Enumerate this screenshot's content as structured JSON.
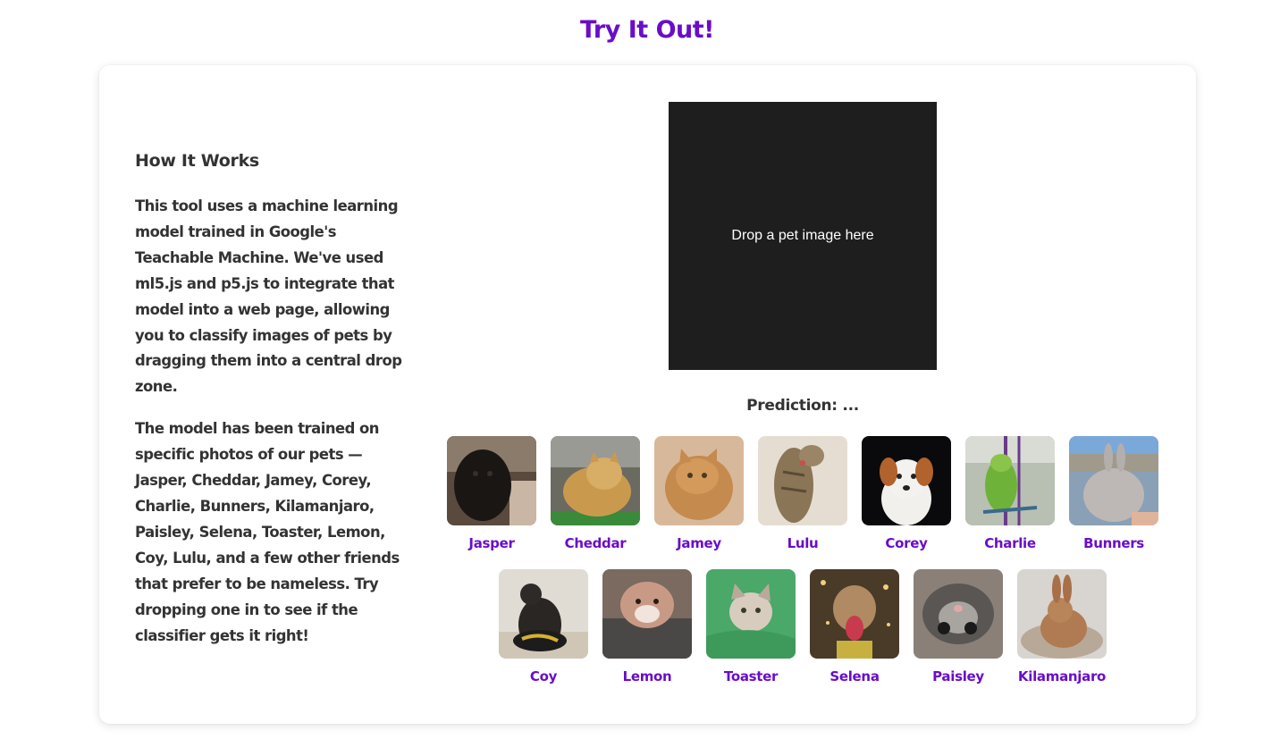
{
  "page": {
    "title": "Try It Out!"
  },
  "info": {
    "heading": "How It Works",
    "paragraph1": "This tool uses a machine learning model trained in Google's Teachable Machine. We've used ml5.js and p5.js to integrate that model into a web page, allowing you to classify images of pets by dragging them into a central drop zone.",
    "paragraph2": "The model has been trained on specific photos of our pets — Jasper, Cheddar, Jamey, Corey, Charlie, Bunners, Kilamanjaro, Paisley, Selena, Toaster, Lemon, Coy, Lulu, and a few other friends that prefer to be nameless. Try dropping one in to see if the classifier gets it right!"
  },
  "drop_zone": {
    "label": "Drop a pet image here"
  },
  "prediction": {
    "text": "Prediction: ..."
  },
  "pets_row1": [
    {
      "name": "Jasper",
      "icon": "dog-photo-icon"
    },
    {
      "name": "Cheddar",
      "icon": "cat-photo-icon"
    },
    {
      "name": "Jamey",
      "icon": "cat-photo-icon"
    },
    {
      "name": "Lulu",
      "icon": "cat-photo-icon"
    },
    {
      "name": "Corey",
      "icon": "dog-photo-icon"
    },
    {
      "name": "Charlie",
      "icon": "bird-photo-icon"
    },
    {
      "name": "Bunners",
      "icon": "rabbit-photo-icon"
    }
  ],
  "pets_row2": [
    {
      "name": "Coy",
      "icon": "dog-photo-icon"
    },
    {
      "name": "Lemon",
      "icon": "dog-photo-icon"
    },
    {
      "name": "Toaster",
      "icon": "cat-photo-icon"
    },
    {
      "name": "Selena",
      "icon": "dog-photo-icon"
    },
    {
      "name": "Paisley",
      "icon": "cat-photo-icon"
    },
    {
      "name": "Kilamanjaro",
      "icon": "rabbit-photo-icon"
    }
  ],
  "colors": {
    "accent": "#6a0dc8",
    "text": "#333333",
    "drop_zone_bg": "#1e1e1e"
  }
}
